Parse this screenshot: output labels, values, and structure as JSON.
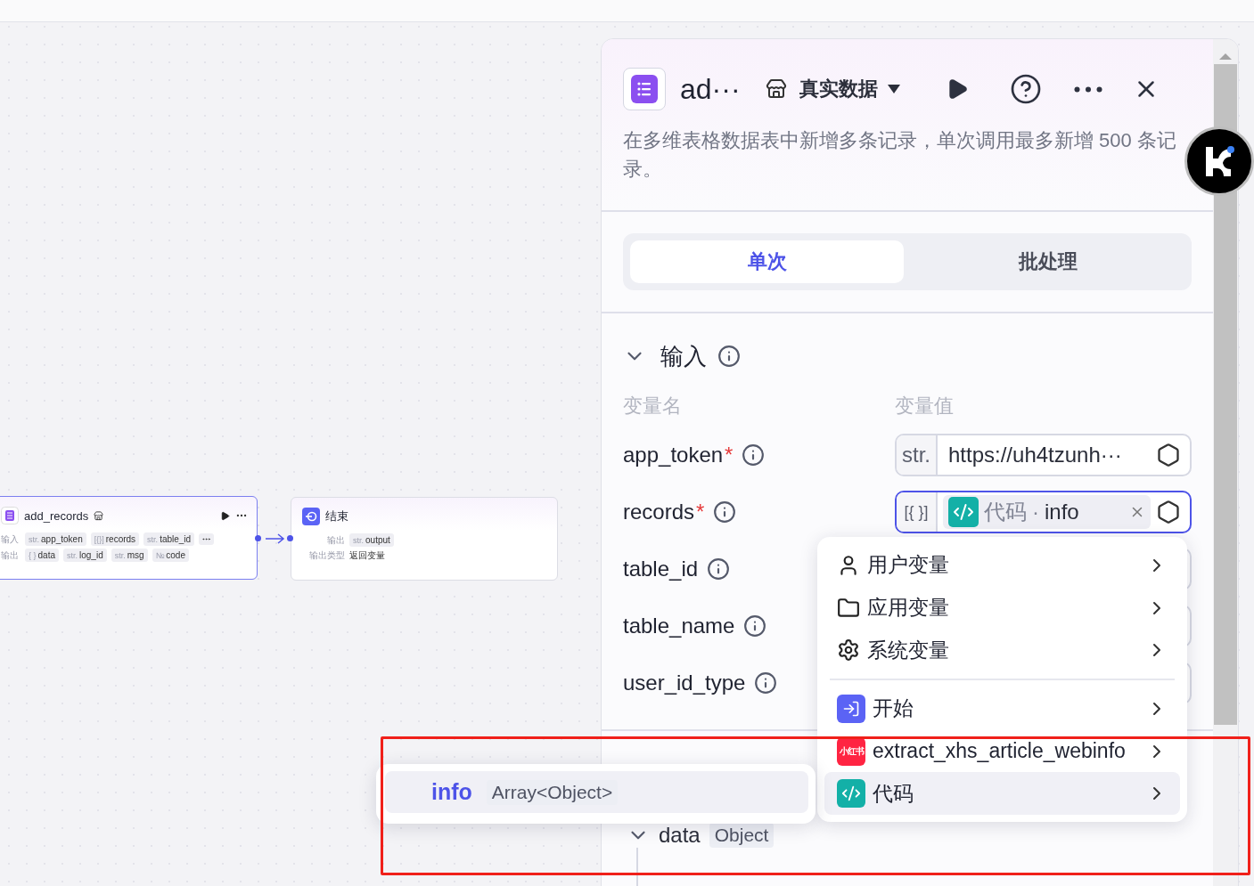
{
  "canvas": {
    "nodes": [
      {
        "kind": "plugin",
        "title": "add_records",
        "selected": true,
        "rows": [
          {
            "label": "输入",
            "tags": [
              {
                "type": "str.",
                "name": "app_token"
              },
              {
                "type": "[{}]",
                "name": "records"
              },
              {
                "type": "str.",
                "name": "table_id"
              }
            ],
            "more": true
          },
          {
            "label": "输出",
            "tags": [
              {
                "type": "{ }",
                "name": "data"
              },
              {
                "type": "str.",
                "name": "log_id"
              },
              {
                "type": "str.",
                "name": "msg"
              },
              {
                "type": "№",
                "name": "code"
              }
            ],
            "more": false
          }
        ]
      },
      {
        "kind": "end",
        "title": "结束",
        "selected": false,
        "rows": [
          {
            "label": "输出",
            "tags": [
              {
                "type": "str.",
                "name": "output"
              }
            ],
            "more": false
          },
          {
            "label": "输出类型",
            "value": "返回变量"
          }
        ]
      }
    ]
  },
  "panel": {
    "title": "ad···",
    "data_mode": "真实数据",
    "description": "在多维表格数据表中新增多条记录，单次调用最多新增 500 条记录。",
    "tabs": [
      {
        "label": "单次",
        "selected": true
      },
      {
        "label": "批处理",
        "selected": false
      }
    ],
    "input": {
      "heading": "输入",
      "expanded": true,
      "columns": [
        "变量名",
        "变量值"
      ],
      "params": [
        {
          "name": "app_token",
          "required_mark": "*",
          "value": {
            "kind": "text",
            "type": "str.",
            "text": "https://uh4tzunh···",
            "focused": false
          }
        },
        {
          "name": "records",
          "required_mark": "*",
          "value": {
            "kind": "ref",
            "type": "[{ }]",
            "source": "代码",
            "separator": "·",
            "field": "info",
            "focused": true
          }
        },
        {
          "name": "table_id",
          "value": {
            "kind": "empty",
            "focused": false
          }
        },
        {
          "name": "table_name",
          "value": {
            "kind": "empty",
            "focused": false
          }
        },
        {
          "name": "user_id_type",
          "value": {
            "kind": "empty",
            "focused": false
          }
        }
      ]
    },
    "output": {
      "tree": [
        {
          "name": "data",
          "type": "Object",
          "expanded": true
        }
      ]
    }
  },
  "variable_menu": {
    "groups": [
      {
        "kind": "user",
        "label": "用户变量"
      },
      {
        "kind": "folder",
        "label": "应用变量"
      },
      {
        "kind": "gear",
        "label": "系统变量"
      }
    ],
    "nodes": [
      {
        "kind": "start",
        "label": "开始",
        "selected": false
      },
      {
        "kind": "xhs",
        "label": "extract_xhs_article_webinfo",
        "logo_text": "小红书",
        "selected": false
      },
      {
        "kind": "code",
        "label": "代码",
        "selected": true
      }
    ]
  },
  "field_popover": {
    "fields": [
      {
        "name": "info",
        "type": "Array<Object>",
        "selected": true
      }
    ]
  }
}
